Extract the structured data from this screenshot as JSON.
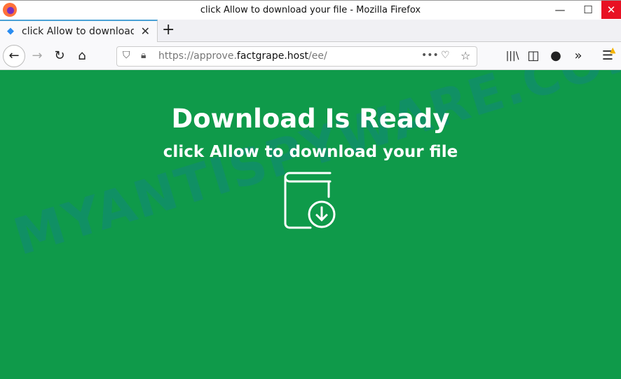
{
  "window": {
    "title": "click Allow to download your file - Mozilla Firefox",
    "minimize": "—",
    "maximize": "☐",
    "close": "✕"
  },
  "tab": {
    "label": "click Allow to download your file",
    "close": "✕",
    "new_tab": "+"
  },
  "nav": {
    "back": "←",
    "forward": "→",
    "reload": "↻",
    "home": "⌂"
  },
  "urlbar": {
    "prefix": "https://approve.",
    "domain": "factgrape.host",
    "suffix": "/ee/",
    "more": "•••"
  },
  "toolbar": {
    "library": "|||\\",
    "sidebar": "◫",
    "overflow": "»",
    "menu": "☰"
  },
  "page": {
    "heading": "Download Is Ready",
    "subheading": "click Allow to download your file",
    "background": "#0f9a4a"
  },
  "watermark": "MYANTISPYWARE.COM"
}
